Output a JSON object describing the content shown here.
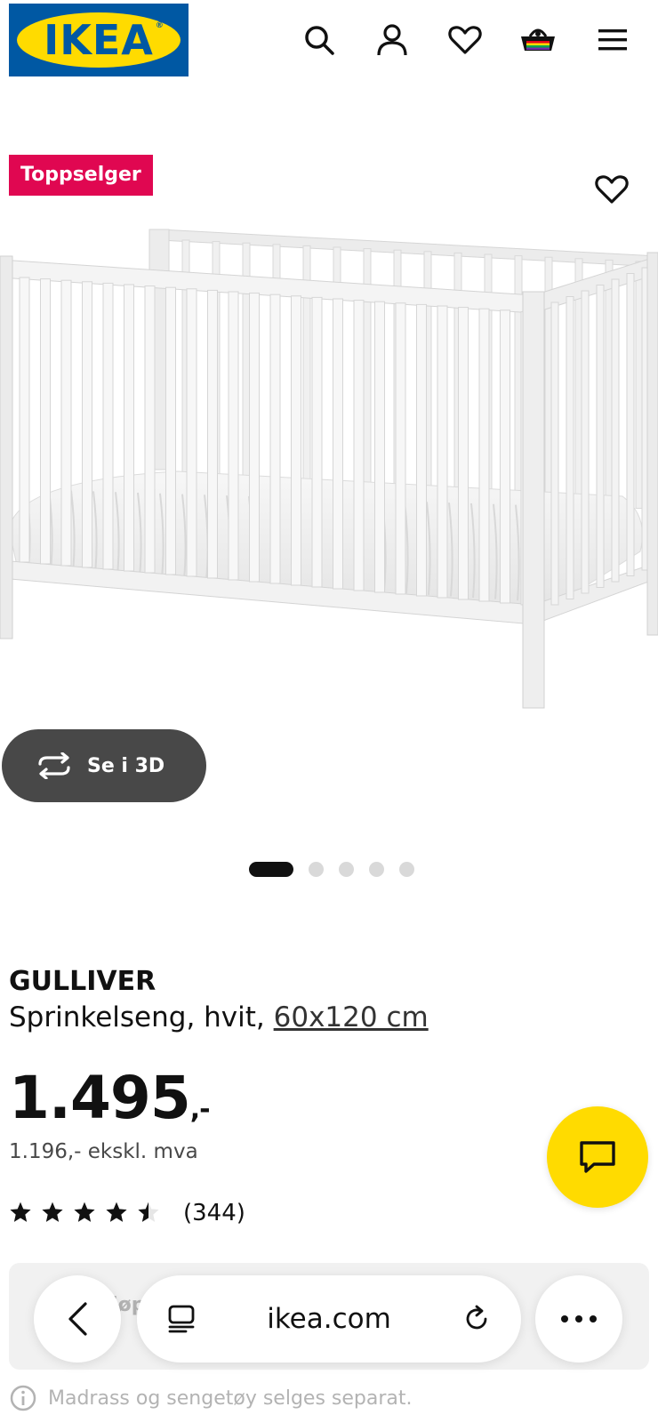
{
  "header": {
    "logo_text": "IKEA",
    "icons": [
      "search-icon",
      "user-icon",
      "heart-icon",
      "basket-icon",
      "menu-icon"
    ],
    "brand_blue": "#0058a3",
    "brand_yellow": "#ffdb00"
  },
  "gallery": {
    "badge": "Toppselger",
    "badge_color": "#e00751",
    "view_3d_label": "Se i 3D",
    "slide_count": 5,
    "active_slide": 1
  },
  "product": {
    "name": "GULLIVER",
    "description": "Sprinkelseng, hvit, ",
    "size": "60x120 cm",
    "price": "1.495",
    "price_suffix": ",-",
    "price_ex_vat": "1.196,- ekskl. mva",
    "rating": 4.5,
    "review_count": "(344)"
  },
  "below_fold": {
    "partial_text": "Kjøp i detal...",
    "note": "Madrass og sengetøy selges separat."
  },
  "browser": {
    "url": "ikea.com"
  }
}
